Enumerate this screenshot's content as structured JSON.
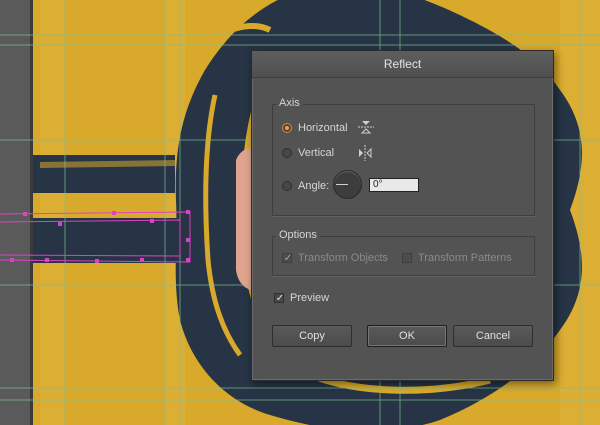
{
  "dialog": {
    "title": "Reflect",
    "axis": {
      "label": "Axis",
      "horizontal_label": "Horizontal",
      "vertical_label": "Vertical",
      "angle_label": "Angle:",
      "angle_value": "0°",
      "selected": "horizontal"
    },
    "options": {
      "label": "Options",
      "transform_objects_label": "Transform Objects",
      "transform_objects_checked": true,
      "transform_patterns_label": "Transform Patterns",
      "transform_patterns_checked": false
    },
    "preview": {
      "label": "Preview",
      "checked": true
    },
    "buttons": {
      "copy": "Copy",
      "ok": "OK",
      "cancel": "Cancel"
    }
  },
  "colors": {
    "canvas_yellow": "#d9a92b",
    "dark_navy": "#263445",
    "selection_magenta": "#e040c8",
    "peach": "#e0a48e",
    "dialog_bg": "#535353",
    "radio_accent": "#f0a040"
  }
}
